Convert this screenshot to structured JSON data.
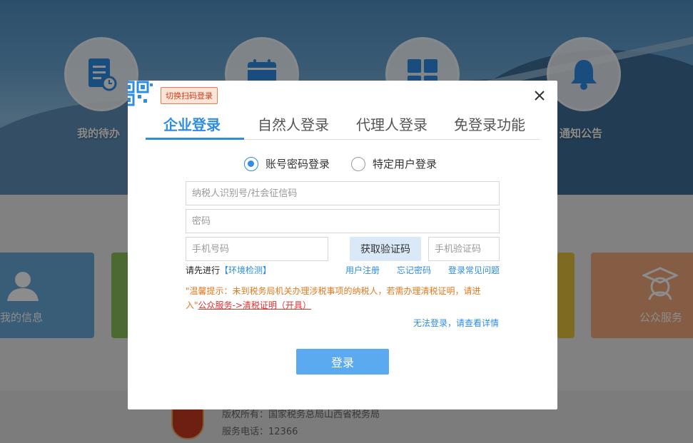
{
  "background": {
    "icons": [
      {
        "label": "我的待办",
        "icon": "document-clock-icon"
      },
      {
        "label": "",
        "icon": "calendar-icon"
      },
      {
        "label": "",
        "icon": "grid-icon"
      },
      {
        "label": "通知公告",
        "icon": "bell-icon"
      }
    ],
    "tiles": [
      {
        "label": "我的信息",
        "icon": "user-icon"
      },
      {
        "label": "公众服务",
        "icon": "graduate-icon"
      }
    ],
    "footer": {
      "copyright": "版权所有：国家税务总局山西省税务局",
      "phone": "服务电话：12366"
    }
  },
  "dialog": {
    "qr_switch_label": "切换扫码登录",
    "tabs": [
      {
        "label": "企业登录",
        "active": true
      },
      {
        "label": "自然人登录",
        "active": false
      },
      {
        "label": "代理人登录",
        "active": false
      },
      {
        "label": "免登录功能",
        "active": false
      }
    ],
    "login_modes": [
      {
        "label": "账号密码登录",
        "checked": true
      },
      {
        "label": "特定用户登录",
        "checked": false
      }
    ],
    "fields": {
      "taxpayer_id_placeholder": "纳税人识别号/社会征信码",
      "password_placeholder": "密码",
      "phone_placeholder": "手机号码",
      "sms_code_placeholder": "手机验证码"
    },
    "get_code_label": "获取验证码",
    "env_check_prefix": "请先进行",
    "env_check_link": "【环境检测】",
    "links": {
      "register": "用户注册",
      "forgot_password": "忘记密码",
      "faq": "登录常见问题"
    },
    "tip_text": "\"温馨提示：未到税务局机关办理涉税事项的纳税人，若需办理清税证明，请进入\"",
    "tip_link": "公众服务->清税证明（开具）",
    "help_link": "无法登录，请查看详情",
    "login_button": "登录"
  },
  "colors": {
    "accent": "#2d8ce3",
    "login_button": "#5baaf0",
    "tip_text": "#e07a1f",
    "tip_link": "#e23030"
  }
}
